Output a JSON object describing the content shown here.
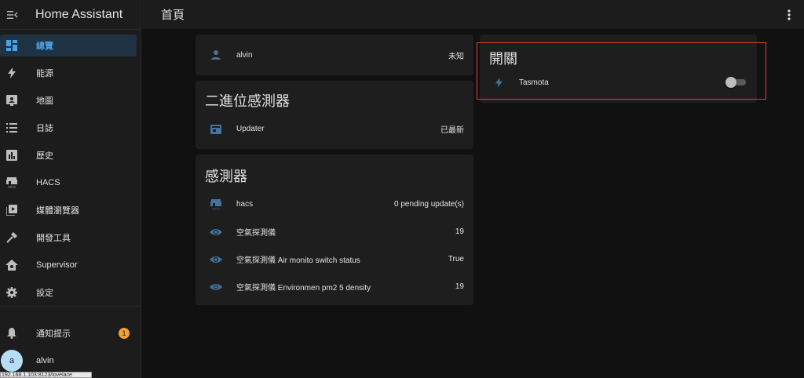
{
  "app": {
    "title": "Home Assistant"
  },
  "sidebar": {
    "items": [
      {
        "label": "總覽",
        "icon": "dashboard-icon"
      },
      {
        "label": "能源",
        "icon": "lightning-icon"
      },
      {
        "label": "地圖",
        "icon": "map-icon"
      },
      {
        "label": "日誌",
        "icon": "logbook-icon"
      },
      {
        "label": "歷史",
        "icon": "history-icon"
      },
      {
        "label": "HACS",
        "icon": "hacs-icon"
      },
      {
        "label": "媒體瀏覽器",
        "icon": "media-icon"
      },
      {
        "label": "開發工具",
        "icon": "hammer-icon"
      },
      {
        "label": "Supervisor",
        "icon": "supervisor-icon"
      },
      {
        "label": "設定",
        "icon": "gear-icon"
      }
    ],
    "notifications": {
      "label": "通知提示",
      "count": "1"
    },
    "user": {
      "initial": "a",
      "name": "alvin"
    },
    "status_url": "192.168.1.103:8123/lovelace"
  },
  "header": {
    "title": "首頁"
  },
  "cards": {
    "person": {
      "name": "alvin",
      "state": "未知"
    },
    "binary_sensor": {
      "title": "二進位感測器",
      "rows": [
        {
          "name": "Updater",
          "value": "已最新"
        }
      ]
    },
    "sensor": {
      "title": "感測器",
      "rows": [
        {
          "name": "hacs",
          "value": "0 pending update(s)"
        },
        {
          "name": "空氣探測儀",
          "value": "19"
        },
        {
          "name": "空氣探測儀 Air monito switch status",
          "value": "True"
        },
        {
          "name": "空氣探測儀 Environmen pm2 5 density",
          "value": "19"
        }
      ]
    },
    "switch": {
      "title": "開關",
      "rows": [
        {
          "name": "Tasmota",
          "state": "off"
        }
      ]
    }
  },
  "colors": {
    "accent": "#4aa1e8",
    "icon_blue": "#44739e",
    "highlight": "#e5412b",
    "badge": "#f0a12b"
  }
}
